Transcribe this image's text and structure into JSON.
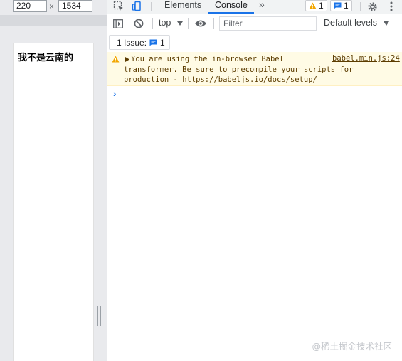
{
  "device": {
    "width_value": "220",
    "height_value": "1534",
    "times": "×",
    "page_text": "我不是云南的"
  },
  "devtools": {
    "tabs": [
      "Elements",
      "Console"
    ],
    "more_tabs": "»",
    "warnings_count": "1",
    "messages_count": "1",
    "toolbar": {
      "context": "top",
      "filter_placeholder": "Filter",
      "levels": "Default levels"
    },
    "issues": {
      "label": "1 Issue:",
      "count": "1"
    },
    "console": {
      "warning_line1": "You are using the in-browser Babel",
      "warning_line2": "transformer. Be sure to precompile your scripts for",
      "warning_line3": "production - ",
      "warning_link": "https://babeljs.io/docs/setup/",
      "warning_source": "babel.min.js:24",
      "prompt": "›"
    }
  },
  "watermark": "@稀土掘金技术社区",
  "colors": {
    "accent": "#1a73e8",
    "warning_bg": "#fffbe5",
    "warning_text": "#5c3c00",
    "warning_icon": "#f2a600"
  }
}
